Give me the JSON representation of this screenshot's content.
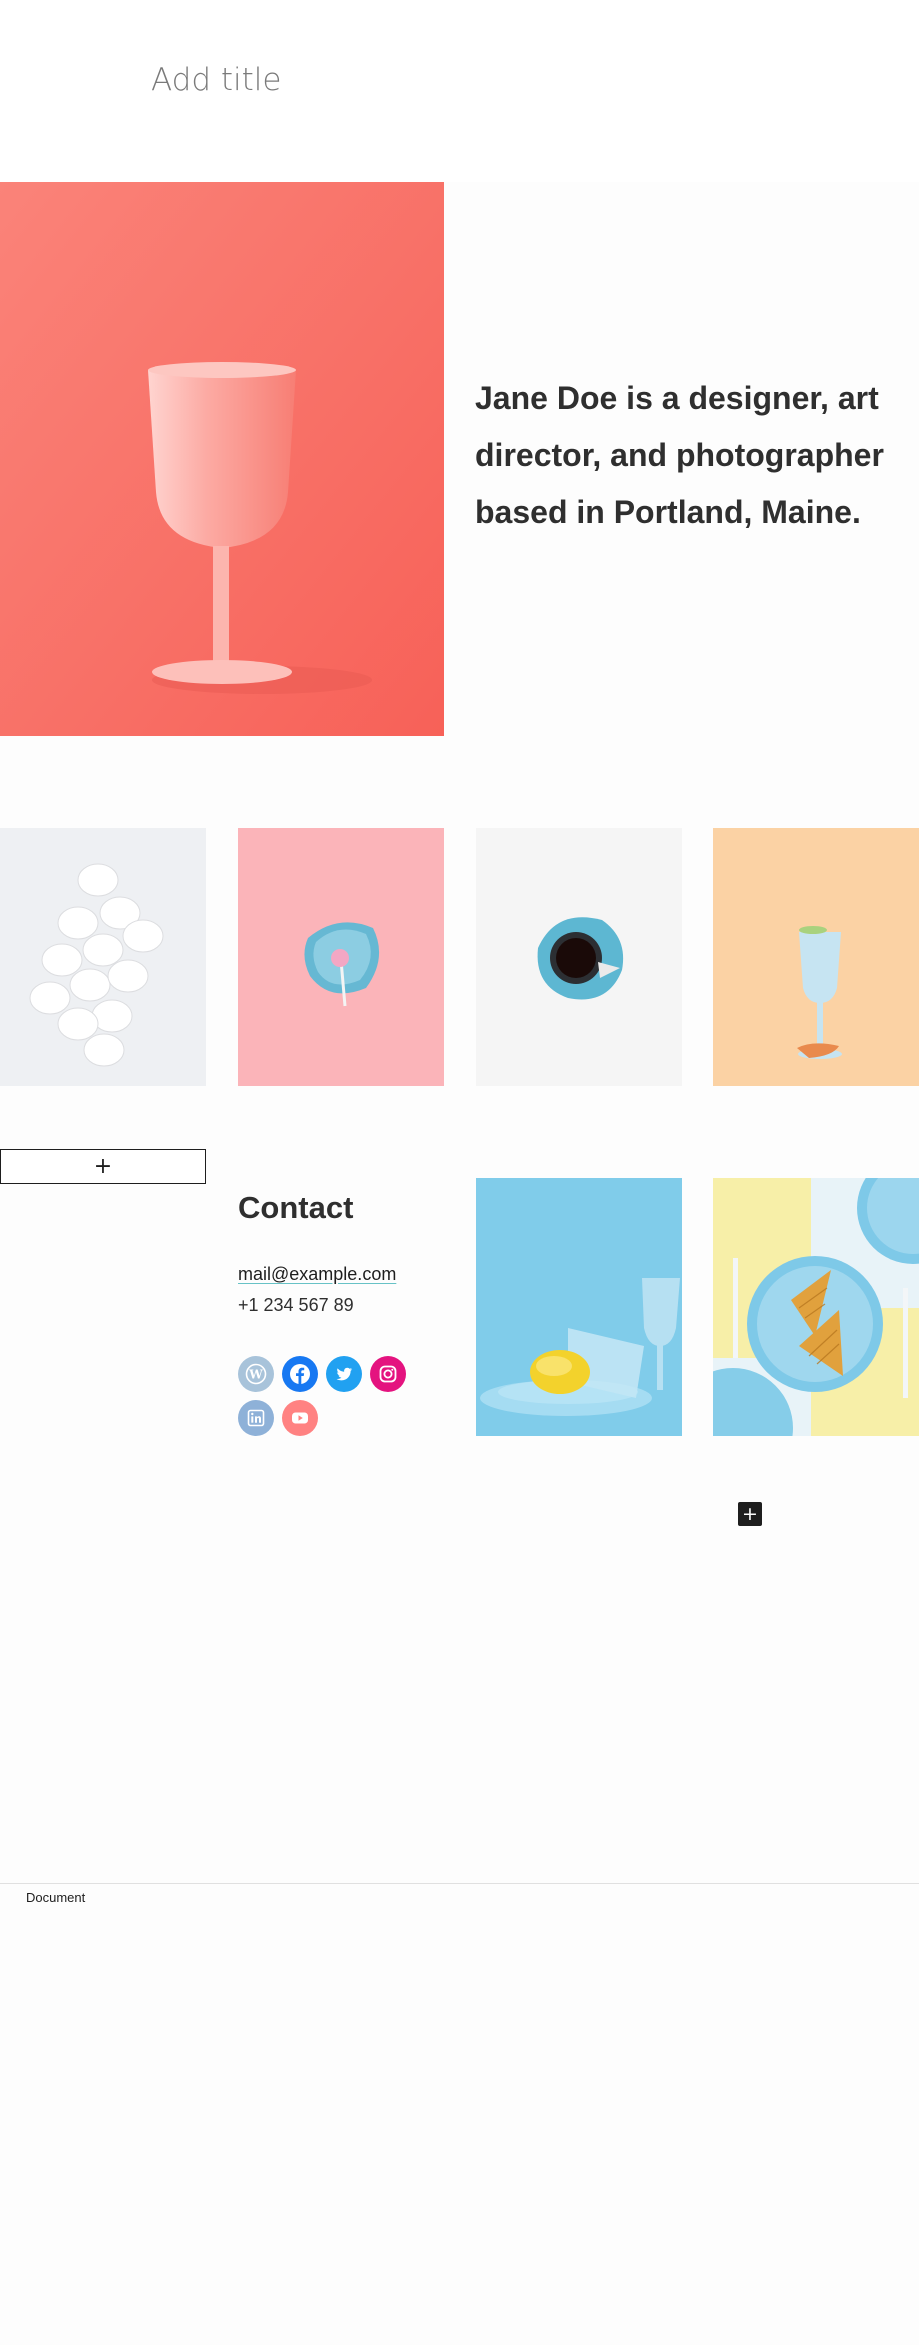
{
  "editor": {
    "title_placeholder": "Add title",
    "add_block_label": "+",
    "inserter_label": "+",
    "breadcrumb": "Document"
  },
  "hero": {
    "text": "Jane Doe is a designer, art director, and photographer based in Portland, Maine.",
    "image_icon": "pink-wine-glass-photo",
    "background_color": "#f8726a"
  },
  "gallery": [
    {
      "icon": "eggs-photo",
      "background_color": "#eef0f3"
    },
    {
      "icon": "pink-lollipop-on-blue-plate-photo",
      "background_color": "#fbb4b9"
    },
    {
      "icon": "coffee-cup-photo",
      "background_color": "#f5f5f5"
    },
    {
      "icon": "blue-glass-with-lime-photo",
      "background_color": "#fbd2a4"
    }
  ],
  "contact": {
    "heading": "Contact",
    "email": "mail@example.com",
    "phone": "+1 234 567 89",
    "social": [
      {
        "name": "WordPress",
        "icon": "wordpress-icon",
        "color": "#a8c3da"
      },
      {
        "name": "Facebook",
        "icon": "facebook-icon",
        "color": "#1778f2"
      },
      {
        "name": "Twitter",
        "icon": "twitter-icon",
        "color": "#21a1f1"
      },
      {
        "name": "Instagram",
        "icon": "instagram-icon",
        "color": "#e4137f"
      },
      {
        "name": "LinkedIn",
        "icon": "linkedin-icon",
        "color": "#8eb1d8"
      },
      {
        "name": "YouTube",
        "icon": "youtube-icon",
        "color": "#ff8282"
      }
    ]
  },
  "photos": [
    {
      "icon": "lemon-and-blue-glasses-photo",
      "background_color": "#7dcbea"
    },
    {
      "icon": "waffles-on-blue-plate-photo",
      "background_color": "#f7efa8"
    }
  ]
}
